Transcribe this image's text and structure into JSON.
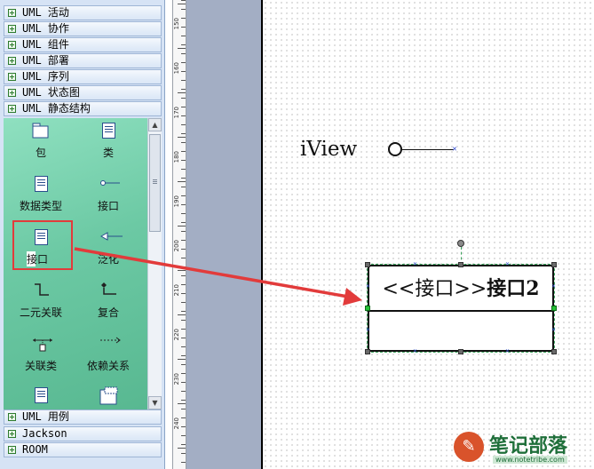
{
  "stencil": {
    "categories_top": [
      "UML 活动",
      "UML 协作",
      "UML 组件",
      "UML 部署",
      "UML 序列",
      "UML 状态图",
      "UML 静态结构"
    ],
    "shapes": [
      {
        "label": "包",
        "icon": "package-icon"
      },
      {
        "label": "类",
        "icon": "class-icon"
      },
      {
        "label": "数据类型",
        "icon": "datatype-icon"
      },
      {
        "label": "接口",
        "icon": "interface-icon"
      },
      {
        "label": "接口",
        "icon": "interface-class-icon"
      },
      {
        "label": "泛化",
        "icon": "generalization-icon"
      },
      {
        "label": "二元关联",
        "icon": "binary-association-icon"
      },
      {
        "label": "复合",
        "icon": "composition-icon"
      },
      {
        "label": "关联类",
        "icon": "association-class-icon"
      },
      {
        "label": "依赖关系",
        "icon": "dependency-icon"
      },
      {
        "label": "",
        "icon": "class-icon"
      },
      {
        "label": "",
        "icon": "parameterized-class-icon"
      }
    ],
    "categories_bottom": [
      "UML 用例",
      "Jackson",
      "ROOM"
    ]
  },
  "ruler": {
    "labels": [
      "150",
      "160",
      "170",
      "180",
      "190",
      "200",
      "210",
      "220",
      "230",
      "240"
    ]
  },
  "canvas": {
    "interface_label": "iView",
    "class_shape": {
      "stereotype": "<<接口>>",
      "name": "接口2"
    }
  },
  "watermark": {
    "title": "笔记部落",
    "url": "www.notetribe.com"
  },
  "colors": {
    "annotation_red": "#e23b3b",
    "selection_green": "#24c136",
    "stencil_bg": "#6cc9a4"
  }
}
